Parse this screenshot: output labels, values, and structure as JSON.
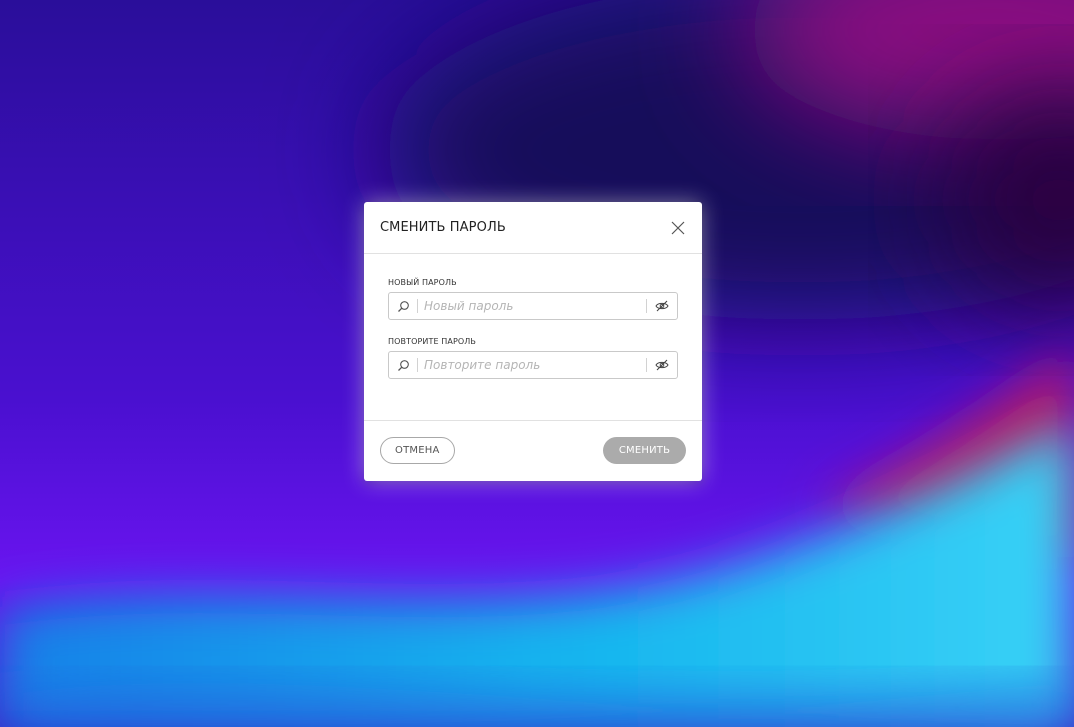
{
  "colors": {
    "backdrop_deep": "#1a0b6e",
    "backdrop_violet": "#5a12e0",
    "backdrop_magenta": "#b0156e",
    "backdrop_cyan": "#1ec8f0",
    "submit_disabled": "#ababab"
  },
  "dialog": {
    "title": "СМЕНИТЬ ПАРОЛЬ",
    "close_icon": "close-icon",
    "fields": {
      "new_password": {
        "label": "НОВЫЙ ПАРОЛЬ",
        "placeholder": "Новый пароль",
        "value": "",
        "left_icon": "search-icon",
        "right_icon": "eye-off-icon"
      },
      "repeat_password": {
        "label": "ПОВТОРИТЕ ПАРОЛЬ",
        "placeholder": "Повторите пароль",
        "value": "",
        "left_icon": "search-icon",
        "right_icon": "eye-off-icon"
      }
    },
    "buttons": {
      "cancel_label": "ОТМЕНА",
      "submit_label": "СМЕНИТЬ"
    }
  }
}
